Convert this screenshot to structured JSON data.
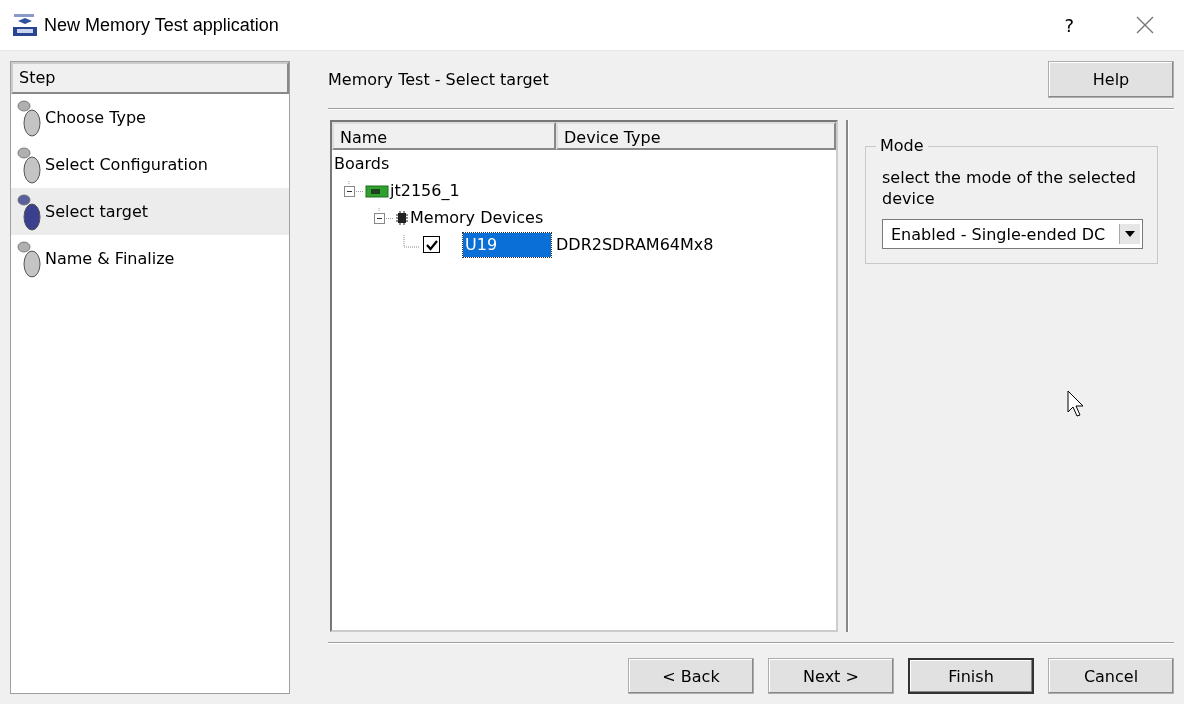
{
  "window": {
    "title": "New Memory Test application",
    "help_button": "?"
  },
  "steps": {
    "header": "Step",
    "items": [
      {
        "label": "Choose Type",
        "selected": false
      },
      {
        "label": "Select Configuration",
        "selected": false
      },
      {
        "label": "Select target",
        "selected": true
      },
      {
        "label": "Name & Finalize",
        "selected": false
      }
    ]
  },
  "page_title": "Memory Test - Select target",
  "help_button": "Help",
  "tree": {
    "columns": [
      "Name",
      "Device Type"
    ],
    "nodes": [
      {
        "kind": "root",
        "label": "Boards",
        "children": [
          {
            "kind": "board",
            "label": "jt2156_1",
            "expanded": true,
            "children": [
              {
                "kind": "group",
                "label": "Memory Devices",
                "expanded": true,
                "children": [
                  {
                    "kind": "device",
                    "label": "U19",
                    "checked": true,
                    "selected": true,
                    "device_type": "DDR2SDRAM64Mx8"
                  }
                ]
              }
            ]
          }
        ]
      }
    ]
  },
  "mode": {
    "legend": "Mode",
    "description": "select the mode of the selected device",
    "value": "Enabled - Single-ended DC"
  },
  "buttons": [
    {
      "label": "< Back",
      "default": false
    },
    {
      "label": "Next >",
      "default": false
    },
    {
      "label": "Finish",
      "default": true
    },
    {
      "label": "Cancel",
      "default": false
    }
  ]
}
